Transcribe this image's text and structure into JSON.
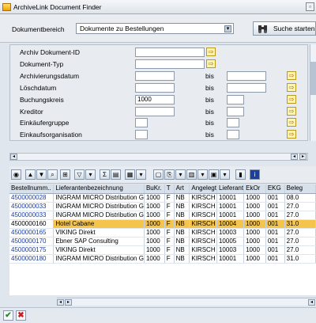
{
  "window": {
    "title": "ArchiveLink Document Finder",
    "close_glyph": "▫"
  },
  "toolbar": {
    "bereich_label": "Dokumentbereich",
    "bereich_value": "Dokumente zu Bestellungen",
    "search_label": "Suche starten"
  },
  "criteria": [
    {
      "label": "Archiv Dokument-ID",
      "value": "",
      "has_bis": false
    },
    {
      "label": "Dokument-Typ",
      "value": "",
      "has_bis": false
    },
    {
      "label": "Archivierungsdatum",
      "value": "",
      "has_bis": true,
      "bis": "bis"
    },
    {
      "label": "Löschdatum",
      "value": "",
      "has_bis": true,
      "bis": "bis"
    },
    {
      "label": "Buchungskreis",
      "value": "1000",
      "has_bis": true,
      "bis": "bis"
    },
    {
      "label": "Kreditor",
      "value": "",
      "has_bis": true,
      "bis": "bis"
    },
    {
      "label": "Einkäufergruppe",
      "value": "",
      "has_bis": true,
      "bis": "bis"
    },
    {
      "label": "Einkaufsorganisation",
      "value": "",
      "has_bis": true,
      "bis": "bis"
    }
  ],
  "table": {
    "columns": [
      "Bestellnumm..",
      "Lieferantenbezeichnung",
      "BuKr.",
      "T",
      "Art",
      "Angelegt",
      "Lieferant",
      "EkOr",
      "EKG",
      "Beleg"
    ],
    "rows": [
      [
        "4500000028",
        "INGRAM MICRO Distribution G",
        "1000",
        "F",
        "NB",
        "KIRSCH",
        "10001",
        "1000",
        "001",
        "08.0"
      ],
      [
        "4500000033",
        "INGRAM MICRO Distribution G",
        "1000",
        "F",
        "NB",
        "KIRSCH",
        "10001",
        "1000",
        "001",
        "27.0"
      ],
      [
        "4500000033",
        "INGRAM MICRO Distribution G",
        "1000",
        "F",
        "NB",
        "KIRSCH",
        "10001",
        "1000",
        "001",
        "27.0"
      ],
      [
        "4500000160",
        "Hotel Cabane",
        "1000",
        "F",
        "NB",
        "KIRSCH",
        "10004",
        "1000",
        "001",
        "31.0"
      ],
      [
        "4500000165",
        "VIKING Direkt",
        "1000",
        "F",
        "NB",
        "KIRSCH",
        "10003",
        "1000",
        "001",
        "27.0"
      ],
      [
        "4500000170",
        "Ebner SAP Consulting",
        "1000",
        "F",
        "NB",
        "KIRSCH",
        "10005",
        "1000",
        "001",
        "27.0"
      ],
      [
        "4500000175",
        "VIKING Direkt",
        "1000",
        "F",
        "NB",
        "KIRSCH",
        "10003",
        "1000",
        "001",
        "27.0"
      ],
      [
        "4500000180",
        "INGRAM MICRO Distribution G",
        "1000",
        "F",
        "NB",
        "KIRSCH",
        "10001",
        "1000",
        "001",
        "31.0"
      ]
    ],
    "selected_row": 3
  },
  "colors": {
    "selected_row": "#f5c44d",
    "link_text": "#1a3fa0"
  }
}
